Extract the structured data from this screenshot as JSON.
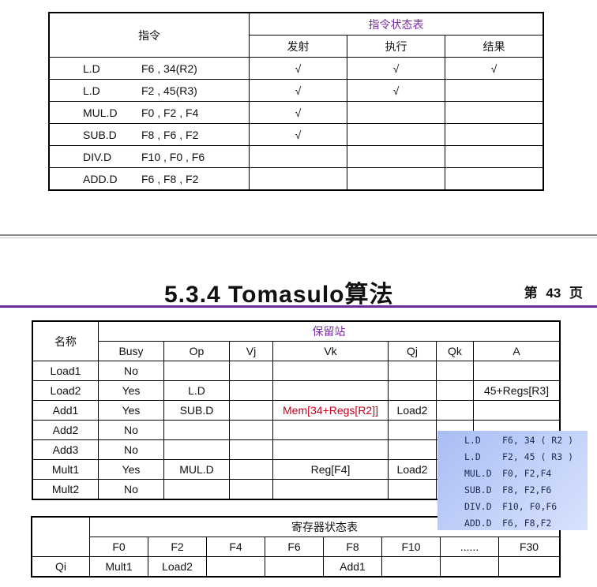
{
  "instruction_status": {
    "header_instruction": "指令",
    "header_group": "指令状态表",
    "col_issue": "发射",
    "col_exec": "执行",
    "col_result": "结果",
    "check_mark": "√",
    "rows": [
      {
        "op": "L.D",
        "operands": "F6 , 34(R2)",
        "issue": "√",
        "exec": "√",
        "result": "√"
      },
      {
        "op": "L.D",
        "operands": "F2 , 45(R3)",
        "issue": "√",
        "exec": "√",
        "result": ""
      },
      {
        "op": "MUL.D",
        "operands": "F0 , F2 , F4",
        "issue": "√",
        "exec": "",
        "result": ""
      },
      {
        "op": "SUB.D",
        "operands": "F8 , F6 , F2",
        "issue": "√",
        "exec": "",
        "result": ""
      },
      {
        "op": "DIV.D",
        "operands": "F10 , F0 , F6",
        "issue": "",
        "exec": "",
        "result": ""
      },
      {
        "op": "ADD.D",
        "operands": "F6 , F8 , F2",
        "issue": "",
        "exec": "",
        "result": ""
      }
    ]
  },
  "title": {
    "text": "5.3.4 Tomasulo算法",
    "page": "第 43 页"
  },
  "reservation_stations": {
    "header_name": "名称",
    "header_group": "保留站",
    "columns": [
      "Busy",
      "Op",
      "Vj",
      "Vk",
      "Qj",
      "Qk",
      "A"
    ],
    "rows": [
      {
        "name": "Load1",
        "busy": "No",
        "op": "",
        "vj": "",
        "vk": "",
        "qj": "",
        "qk": "",
        "a": ""
      },
      {
        "name": "Load2",
        "busy": "Yes",
        "op": "L.D",
        "vj": "",
        "vk": "",
        "qj": "",
        "qk": "",
        "a": "45+Regs[R3]"
      },
      {
        "name": "Add1",
        "busy": "Yes",
        "op": "SUB.D",
        "vj": "",
        "vk": "Mem[34+Regs[R2]]",
        "qj": "Load2",
        "qk": "",
        "a": ""
      },
      {
        "name": "Add2",
        "busy": "No",
        "op": "",
        "vj": "",
        "vk": "",
        "qj": "",
        "qk": "",
        "a": ""
      },
      {
        "name": "Add3",
        "busy": "No",
        "op": "",
        "vj": "",
        "vk": "",
        "qj": "",
        "qk": "",
        "a": ""
      },
      {
        "name": "Mult1",
        "busy": "Yes",
        "op": "MUL.D",
        "vj": "",
        "vk": "Reg[F4]",
        "qj": "Load2",
        "qk": "",
        "a": ""
      },
      {
        "name": "Mult2",
        "busy": "No",
        "op": "",
        "vj": "",
        "vk": "",
        "qj": "",
        "qk": "",
        "a": ""
      }
    ]
  },
  "register_status": {
    "header_group": "寄存器状态表",
    "registers": [
      "F0",
      "F2",
      "F4",
      "F6",
      "F8",
      "F10",
      "......",
      "F30"
    ],
    "row_label": "Qi",
    "values": [
      "Mult1",
      "Load2",
      "",
      "",
      "Add1",
      "",
      "",
      ""
    ]
  },
  "code_box": {
    "lines": [
      {
        "op": "L.D",
        "args": "F6, 34 ( R2 )"
      },
      {
        "op": "L.D",
        "args": "F2, 45 ( R3 )"
      },
      {
        "op": "MUL.D",
        "args": "F0, F2,F4"
      },
      {
        "op": "SUB.D",
        "args": "F8, F2,F6"
      },
      {
        "op": "DIV.D",
        "args": "F10, F0,F6"
      },
      {
        "op": "ADD.D",
        "args": "F6, F8,F2"
      }
    ]
  },
  "colors": {
    "accent_purple": "#7a2fa0",
    "title_rule": "#6e2a96",
    "value_red": "#c8001e",
    "code_box_bg": "#b7c8f6"
  }
}
